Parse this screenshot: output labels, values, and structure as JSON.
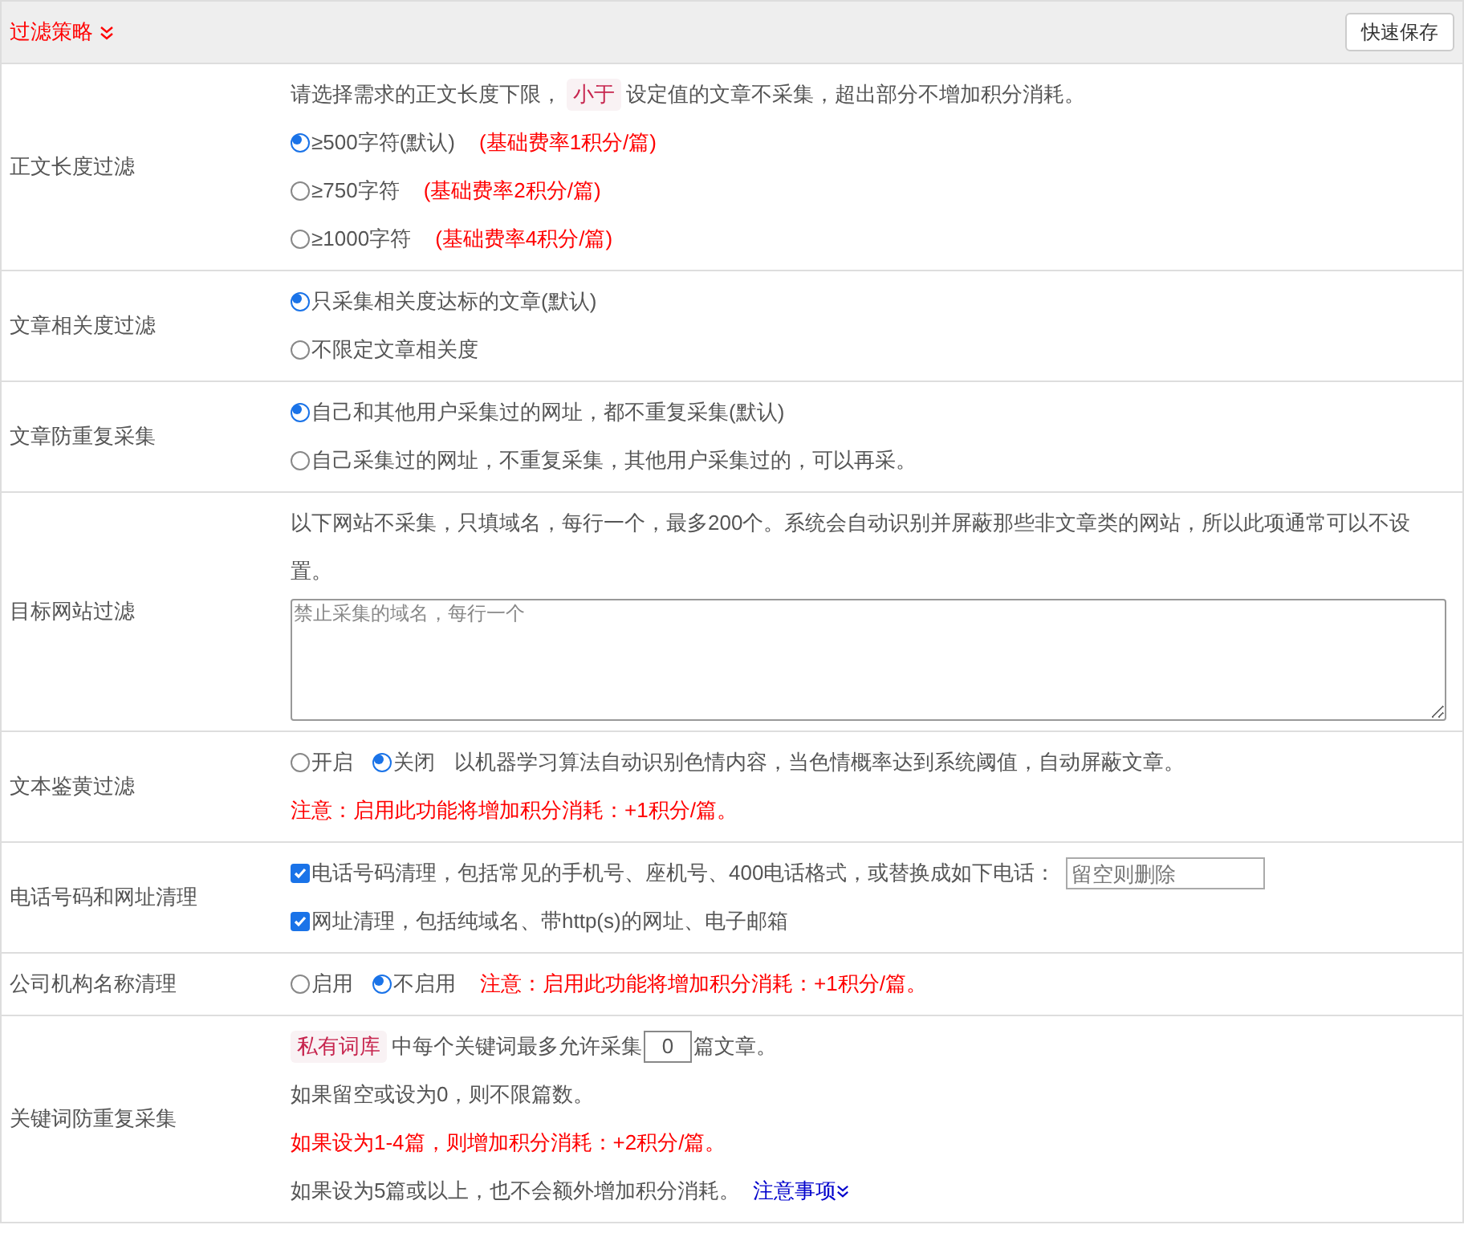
{
  "header": {
    "title": "过滤策略",
    "save_button": "快速保存"
  },
  "rows": [
    {
      "label": "正文长度过滤",
      "lines": [
        [
          {
            "kind": "text",
            "text": "请选择需求的正文长度下限，"
          },
          {
            "kind": "tag",
            "text": "小于"
          },
          {
            "kind": "text",
            "text": "设定值的文章不采集，超出部分不增加积分消耗。"
          }
        ],
        [
          {
            "kind": "radio",
            "text": "≥500字符(默认)",
            "selected": true
          },
          {
            "kind": "note",
            "text": "(基础费率1积分/篇)"
          }
        ],
        [
          {
            "kind": "radio",
            "text": "≥750字符",
            "selected": false
          },
          {
            "kind": "note",
            "text": "(基础费率2积分/篇)"
          }
        ],
        [
          {
            "kind": "radio",
            "text": "≥1000字符",
            "selected": false
          },
          {
            "kind": "note",
            "text": "(基础费率4积分/篇)"
          }
        ]
      ]
    },
    {
      "label": "文章相关度过滤",
      "lines": [
        [
          {
            "kind": "radio",
            "text": "只采集相关度达标的文章(默认)",
            "selected": true
          }
        ],
        [
          {
            "kind": "radio",
            "text": "不限定文章相关度",
            "selected": false
          }
        ]
      ]
    },
    {
      "label": "文章防重复采集",
      "lines": [
        [
          {
            "kind": "radio",
            "text": "自己和其他用户采集过的网址，都不重复采集(默认)",
            "selected": true
          }
        ],
        [
          {
            "kind": "radio",
            "text": "自己采集过的网址，不重复采集，其他用户采集过的，可以再采。",
            "selected": false
          }
        ]
      ]
    },
    {
      "label": "目标网站过滤",
      "lines": [
        [
          {
            "kind": "text",
            "text": "以下网站不采集，只填域名，每行一个，最多200个。系统会自动识别并屏蔽那些非文章类的网站，所以此项通常可以不设置。"
          }
        ],
        [
          {
            "kind": "textarea",
            "placeholder": "禁止采集的域名，每行一个"
          }
        ]
      ]
    },
    {
      "label": "文本鉴黄过滤",
      "lines": [
        [
          {
            "kind": "radio",
            "text": "开启",
            "selected": false
          },
          {
            "kind": "radio",
            "text": "关闭",
            "selected": true
          },
          {
            "kind": "text",
            "text": "以机器学习算法自动识别色情内容，当色情概率达到系统阈值，自动屏蔽文章。"
          }
        ],
        [
          {
            "kind": "note",
            "text": "注意：启用此功能将增加积分消耗：+1积分/篇。"
          }
        ]
      ]
    },
    {
      "label": "电话号码和网址清理",
      "lines": [
        [
          {
            "kind": "checkbox",
            "text": "电话号码清理，包括常见的手机号、座机号、400电话格式，或替换成如下电话：",
            "checked": true
          },
          {
            "kind": "input",
            "placeholder": "留空则删除"
          }
        ],
        [
          {
            "kind": "checkbox",
            "text": "网址清理，包括纯域名、带http(s)的网址、电子邮箱",
            "checked": true
          }
        ]
      ]
    },
    {
      "label": "公司机构名称清理",
      "lines": [
        [
          {
            "kind": "radio",
            "text": "启用",
            "selected": false
          },
          {
            "kind": "radio",
            "text": "不启用",
            "selected": true
          },
          {
            "kind": "note",
            "text": "注意：启用此功能将增加积分消耗：+1积分/篇。"
          }
        ]
      ]
    },
    {
      "label": "关键词防重复采集",
      "lines": [
        [
          {
            "kind": "tag",
            "text": "私有词库"
          },
          {
            "kind": "text",
            "text": "中每个关键词最多允许采集"
          },
          {
            "kind": "number",
            "value": "0"
          },
          {
            "kind": "text",
            "text": "篇文章。"
          }
        ],
        [
          {
            "kind": "text",
            "text": "如果留空或设为0，则不限篇数。"
          }
        ],
        [
          {
            "kind": "note",
            "text": "如果设为1-4篇，则增加积分消耗：+2积分/篇。"
          }
        ],
        [
          {
            "kind": "text",
            "text": "如果设为5篇或以上，也不会额外增加积分消耗。"
          },
          {
            "kind": "link",
            "text": "注意事项"
          }
        ]
      ]
    }
  ]
}
